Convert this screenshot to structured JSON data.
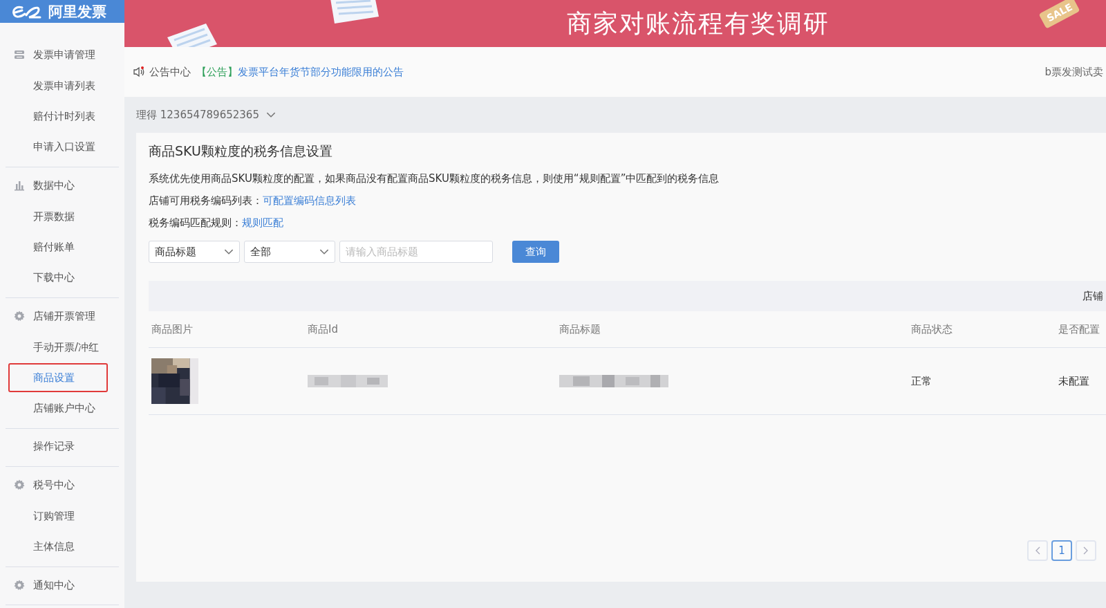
{
  "logo": {
    "text": "阿里发票"
  },
  "banner": {
    "title": "商家对账流程有奖调研",
    "tag": "SALE"
  },
  "sidebar": {
    "groups": [
      {
        "title": "发票申请管理",
        "kind": "list",
        "items": [
          {
            "label": "发票申请列表",
            "selected": false
          },
          {
            "label": "赔付计时列表",
            "selected": false
          },
          {
            "label": "申请入口设置",
            "selected": false
          }
        ]
      },
      {
        "title": "数据中心",
        "kind": "chart",
        "items": [
          {
            "label": "开票数据",
            "selected": false
          },
          {
            "label": "赔付账单",
            "selected": false
          },
          {
            "label": "下载中心",
            "selected": false
          }
        ]
      },
      {
        "title": "店铺开票管理",
        "kind": "gear",
        "items": [
          {
            "label": "手动开票/冲红",
            "selected": false
          },
          {
            "label": "商品设置",
            "selected": true
          },
          {
            "label": "店铺账户中心",
            "selected": false
          }
        ]
      },
      {
        "items": [
          {
            "label": "操作记录",
            "selected": false
          }
        ]
      },
      {
        "title": "税号中心",
        "kind": "gear",
        "items": [
          {
            "label": "订购管理",
            "selected": false
          },
          {
            "label": "主体信息",
            "selected": false
          }
        ]
      },
      {
        "title": "通知中心",
        "kind": "gear"
      }
    ]
  },
  "notice": {
    "label": "公告中心",
    "unread": true,
    "tag": "【公告】",
    "text": "发票平台年货节部分功能限用的公告",
    "user": "b票发测试卖"
  },
  "account": {
    "name": "理得 123654789652365"
  },
  "card": {
    "title": "商品SKU颗粒度的税务信息设置",
    "description": "系统优先使用商品SKU颗粒度的配置，如果商品没有配置商品SKU颗粒度的税务信息，则使用“规则配置”中匹配到的税务信息",
    "links": [
      {
        "label": "店铺可用税务编码列表：",
        "link": "可配置编码信息列表"
      },
      {
        "label": "税务编码匹配规则：",
        "link": "规则匹配"
      }
    ]
  },
  "filters": {
    "field": "商品标题",
    "status": "全部",
    "placeholder": "请输入商品标题",
    "button": "查询"
  },
  "table": {
    "toolbar": "店铺",
    "columns": [
      "商品图片",
      "商品Id",
      "商品标题",
      "商品状态",
      "是否配置"
    ],
    "rows": [
      {
        "id": {
          "kind": "blurred"
        },
        "title": {
          "kind": "blurred"
        },
        "status": "正常",
        "configured": "未配置"
      }
    ]
  },
  "pagination": {
    "pages": [
      {
        "label": "1",
        "selected": true
      }
    ]
  }
}
